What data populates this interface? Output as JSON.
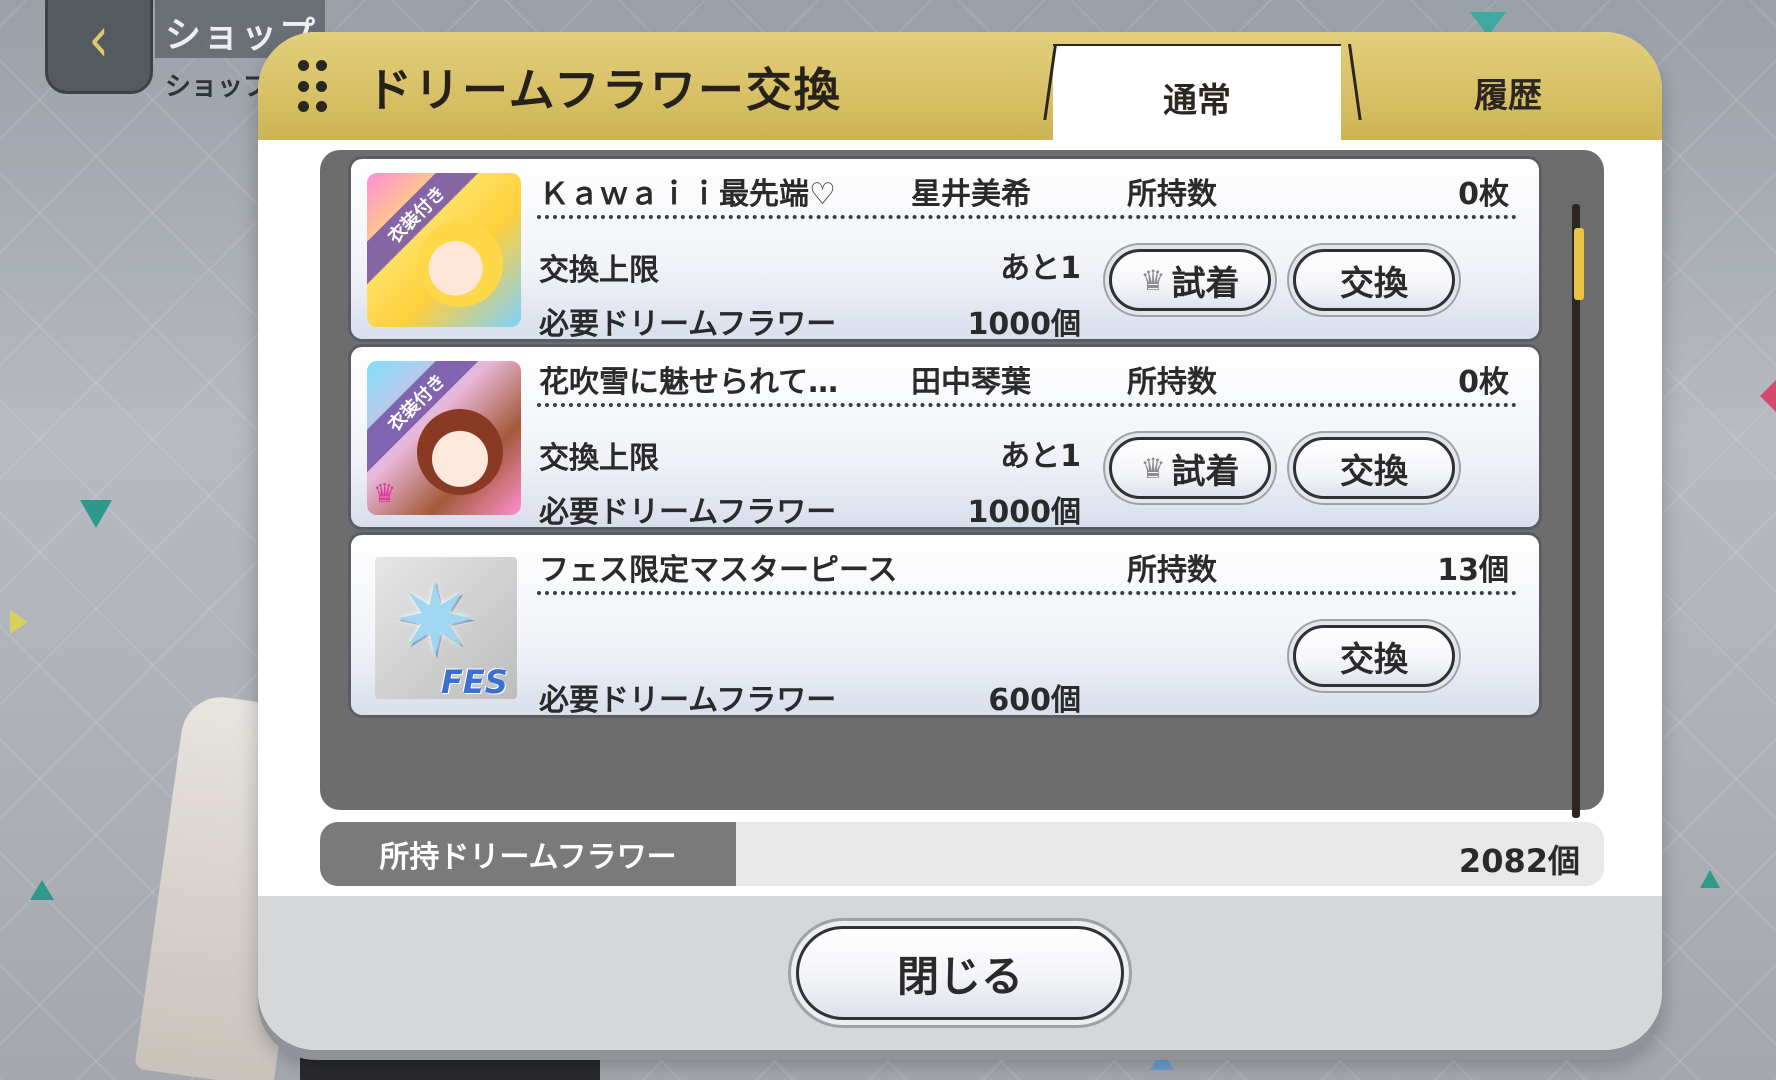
{
  "nav": {
    "back_icon": "chevron-left-icon",
    "title": "ショップ",
    "subtitle": "ショップ"
  },
  "modal": {
    "title": "ドリームフラワー交換",
    "tabs": [
      {
        "label": "通常",
        "active": true
      },
      {
        "label": "履歴",
        "active": false
      }
    ],
    "owned_label": "所持数",
    "limit_label": "交換上限",
    "required_label": "必要ドリームフラワー",
    "try_on_label": "試着",
    "exchange_label": "交換",
    "costume_badge": "衣装付き",
    "items": [
      {
        "name": "Ｋａｗａｉｉ最先端♡",
        "idol": "星井美希",
        "owned": "0枚",
        "limit": "あと1",
        "required": "1000個",
        "has_try_on": true
      },
      {
        "name": "花吹雪に魅せられて…",
        "idol": "田中琴葉",
        "owned": "0枚",
        "limit": "あと1",
        "required": "1000個",
        "has_try_on": true
      },
      {
        "name": "フェス限定マスターピース",
        "idol": "",
        "owned": "13個",
        "limit": "",
        "required": "600個",
        "has_try_on": false,
        "badge": "FES"
      }
    ],
    "balance_label": "所持ドリームフラワー",
    "balance_value": "2082個",
    "close_label": "閉じる"
  },
  "colors": {
    "header_gold": "#d8c168",
    "scroll_thumb": "#e8c444",
    "list_bg": "#6d6d6d",
    "balance_label_bg": "#7a7a7a"
  }
}
